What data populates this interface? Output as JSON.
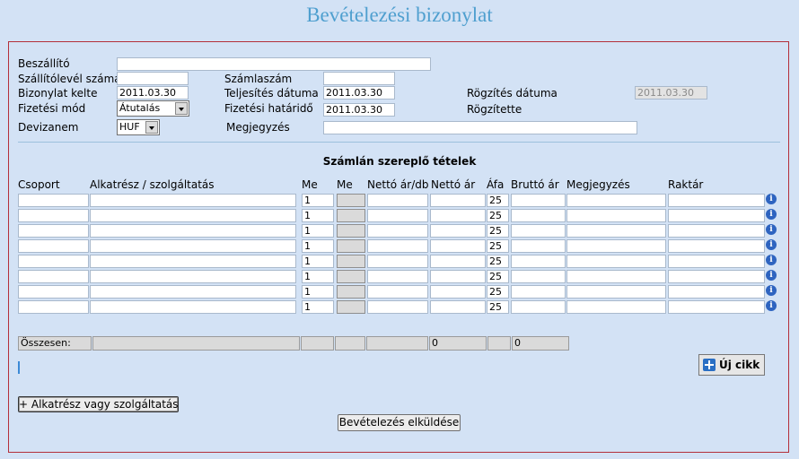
{
  "page": {
    "title": "Bevételezési bizonylat"
  },
  "header_form": {
    "supplier_label": "Beszállító",
    "supplier_value": "",
    "delivery_note_label": "Szállítólevél száma",
    "delivery_note_value": "",
    "invoice_number_label": "Számlaszám",
    "invoice_number_value": "",
    "document_date_label": "Bizonylat kelte",
    "document_date_value": "2011.03.30",
    "fulfillment_date_label": "Teljesítés dátuma",
    "fulfillment_date_value": "2011.03.30",
    "record_date_label": "Rögzítés dátuma",
    "record_date_value": "2011.03.30",
    "payment_method_label": "Fizetési mód",
    "payment_method_value": "Átutalás",
    "payment_deadline_label": "Fizetési határidő",
    "payment_deadline_value": "2011.03.30",
    "recorded_by_label": "Rögzítette",
    "currency_label": "Devizanem",
    "currency_value": "HUF",
    "note_label": "Megjegyzés",
    "note_value": ""
  },
  "items": {
    "section_title": "Számlán szereplő tételek",
    "columns": [
      "Csoport",
      "Alkatrész / szolgáltatás",
      "Me",
      "Me",
      "Nettó ár/db",
      "Nettó ár",
      "Áfa",
      "Bruttó ár",
      "Megjegyzés",
      "Raktár"
    ],
    "rows": [
      {
        "me": "1",
        "afa": "25"
      },
      {
        "me": "1",
        "afa": "25"
      },
      {
        "me": "1",
        "afa": "25"
      },
      {
        "me": "1",
        "afa": "25"
      },
      {
        "me": "1",
        "afa": "25"
      },
      {
        "me": "1",
        "afa": "25"
      },
      {
        "me": "1",
        "afa": "25"
      },
      {
        "me": "1",
        "afa": "25"
      }
    ],
    "info_glyph": "i"
  },
  "totals": {
    "label": "Összesen:",
    "net_total": "0",
    "gross_total": "0"
  },
  "actions": {
    "new_item_label": "Új cikk",
    "add_part_label": "+ Alkatrész vagy szolgáltatás",
    "submit_label": "Bevételezés elküldése"
  }
}
